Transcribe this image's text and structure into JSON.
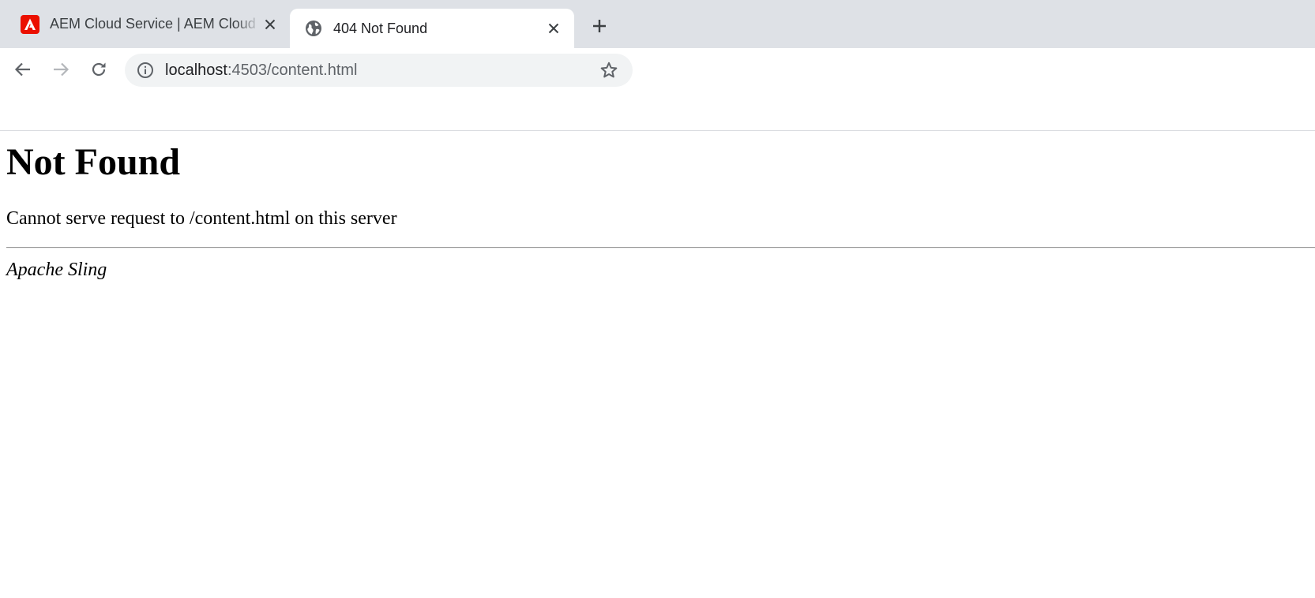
{
  "browser": {
    "tabs": [
      {
        "title": "AEM Cloud Service | AEM Cloud Service",
        "favicon": "adobe-logo-icon",
        "active": false
      },
      {
        "title": "404 Not Found",
        "favicon": "globe-icon",
        "active": true
      }
    ],
    "new_tab_icon": "plus-icon",
    "toolbar": {
      "back_icon": "back-arrow-icon",
      "forward_icon": "forward-arrow-icon",
      "reload_icon": "reload-icon",
      "site_info_icon": "info-icon",
      "bookmark_icon": "star-icon"
    },
    "address": {
      "host": "localhost",
      "path": ":4503/content.html"
    }
  },
  "page": {
    "heading": "Not Found",
    "message": "Cannot serve request to /content.html on this server",
    "footer": "Apache Sling"
  },
  "colors": {
    "tabstrip_bg": "#dee1e6",
    "omnibox_bg": "#f1f3f4",
    "adobe_red": "#eb1000"
  }
}
